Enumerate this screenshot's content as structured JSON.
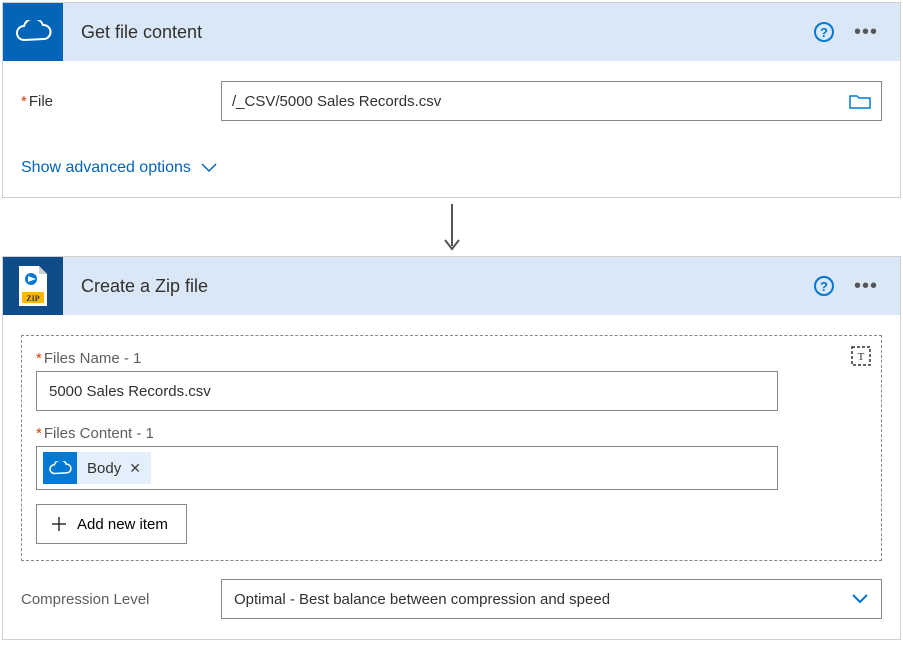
{
  "card1": {
    "title": "Get file content",
    "file_label": "File",
    "file_value": "/_CSV/5000 Sales Records.csv",
    "advanced": "Show advanced options"
  },
  "card2": {
    "title": "Create a Zip file",
    "files_name_label": "Files Name - 1",
    "files_name_value": "5000 Sales Records.csv",
    "files_content_label": "Files Content - 1",
    "token_label": "Body",
    "add_item": "Add new item",
    "compression_label": "Compression Level",
    "compression_value": "Optimal - Best balance between compression and speed"
  }
}
